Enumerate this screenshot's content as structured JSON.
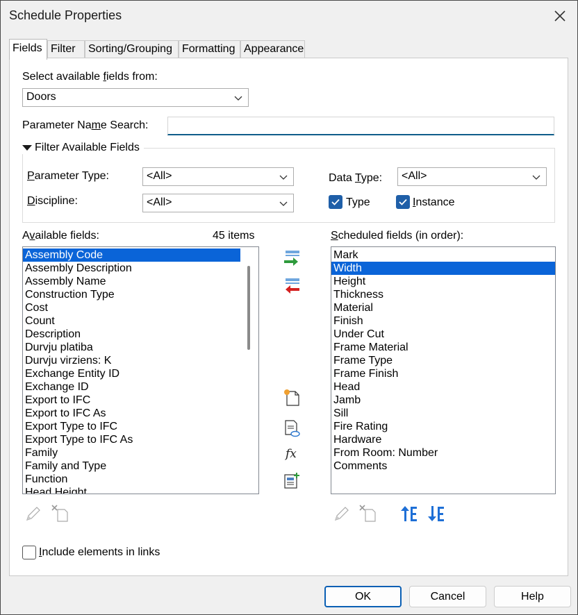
{
  "window": {
    "title": "Schedule Properties"
  },
  "tabs": [
    {
      "label": "Fields"
    },
    {
      "label": "Filter"
    },
    {
      "label": "Sorting/Grouping"
    },
    {
      "label": "Formatting"
    },
    {
      "label": "Appearance"
    }
  ],
  "fields": {
    "select_from_pre": "Select available ",
    "select_from_u": "f",
    "select_from_post": "ields from:",
    "category_value": "Doors",
    "param_search_pre": "Parameter Na",
    "param_search_u": "m",
    "param_search_post": "e Search:",
    "param_search_value": "",
    "filter_section_label": "Filter Available Fields",
    "param_type_u": "P",
    "param_type_post": "arameter Type:",
    "param_type_value": "<All>",
    "discipline_u": "D",
    "discipline_post": "iscipline:",
    "discipline_value": "<All>",
    "data_type_pre": "Data ",
    "data_type_u": "T",
    "data_type_post": "ype:",
    "data_type_value": "<All>",
    "type_check": {
      "label": "Type",
      "checked": true
    },
    "instance_check": {
      "label_u": "I",
      "label_post": "nstance",
      "checked": true
    },
    "available_pre": "A",
    "available_u": "v",
    "available_post": "ailable fields:",
    "item_count": "45 items",
    "scheduled_u": "S",
    "scheduled_post": "cheduled fields (in order):",
    "available_fields": [
      "Assembly Code",
      "Assembly Description",
      "Assembly Name",
      "Construction Type",
      "Cost",
      "Count",
      "Description",
      "Durvju platiba",
      "Durvju virziens: K",
      "Exchange Entity ID",
      "Exchange ID",
      "Export to IFC",
      "Export to IFC As",
      "Export Type to IFC",
      "Export Type to IFC As",
      "Family",
      "Family and Type",
      "Function",
      "Head Height"
    ],
    "available_selected": 0,
    "scheduled_fields": [
      "Mark",
      "Width",
      "Height",
      "Thickness",
      "Material",
      "Finish",
      "Under Cut",
      "Frame Material",
      "Frame Type",
      "Frame Finish",
      "Head",
      "Jamb",
      "Sill",
      "Fire Rating",
      "Hardware",
      "From Room: Number",
      "Comments"
    ],
    "scheduled_selected": 1,
    "include_links_u": "I",
    "include_links_post": "nclude elements in links",
    "include_links_checked": false
  },
  "buttons": {
    "ok": "OK",
    "cancel": "Cancel",
    "help": "Help"
  },
  "colors": {
    "accent": "#0a64d8",
    "checkbox": "#1f5fa8",
    "add_arrow": "#2e9a3c",
    "remove_arrow": "#d42020",
    "move_arrow": "#1e6fd6"
  }
}
